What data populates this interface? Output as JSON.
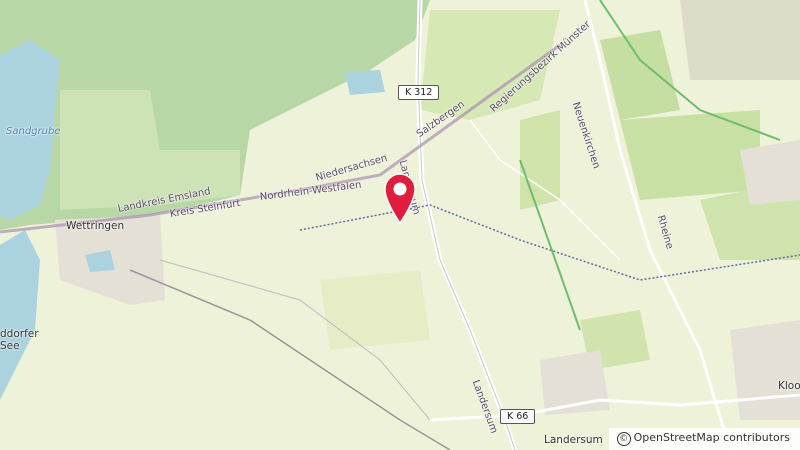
{
  "map": {
    "labels": {
      "sandgrube": "Sandgrube",
      "wettringen": "Wettringen",
      "landkreis_emsland": "Landkreis Emsland",
      "kreis_steinfurt": "Kreis Steinfurt",
      "niedersachsen": "Niedersachsen",
      "nordrhein_westfalen": "Nordrhein-Westfalen",
      "salzbergen": "Salzbergen",
      "landersum_road_top": "Landersum",
      "landersum_road_bottom": "Landersum",
      "regierungsbezirk": "Regierungsbezirk Münster",
      "neuenkirchen": "Neuenkirchen",
      "rheine": "Rheine",
      "dorfer_see": "ddorfer\nSee",
      "klooster": "Kloo",
      "landersum_place": "Landersum"
    },
    "shields": {
      "k312": "K 312",
      "k66": "K 66"
    },
    "attribution": {
      "symbol": "©",
      "text": "OpenStreetMap contributors"
    },
    "colors": {
      "background": "#eef2d8",
      "forest": "#add19e",
      "water": "#aad3df",
      "pin": "#e21c3c"
    }
  }
}
